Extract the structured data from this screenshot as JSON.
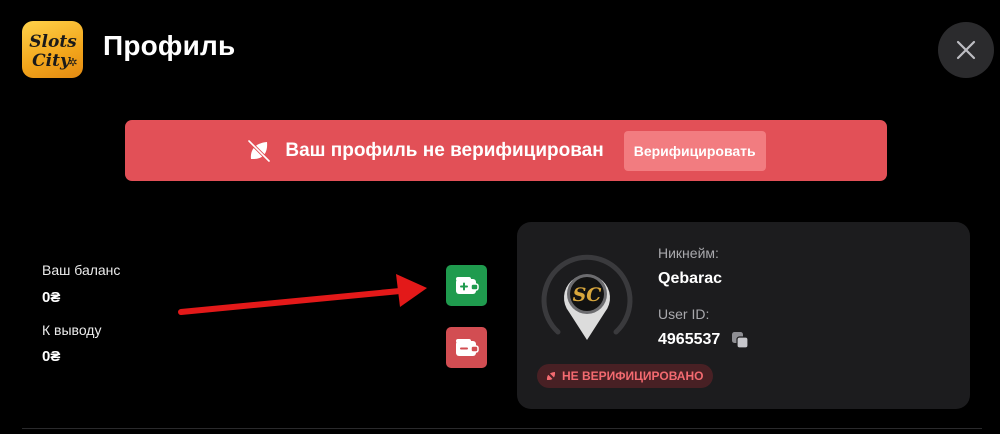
{
  "header": {
    "logo_text": "Slots City",
    "title": "Профиль",
    "close_icon": "close-icon"
  },
  "banner": {
    "icon": "unverified-leaf-icon",
    "text": "Ваш профиль не верифицирован",
    "button_label": "Верифицировать",
    "color": "#e25057"
  },
  "balance": {
    "balance_label": "Ваш баланс",
    "balance_value": "0₴",
    "withdraw_label": "К выводу",
    "withdraw_value": "0₴"
  },
  "actions": {
    "deposit_icon": "wallet-plus-icon",
    "withdraw_icon": "wallet-minus-icon",
    "deposit_color": "#1f9b4e",
    "withdraw_color": "#d24d52"
  },
  "profile": {
    "nickname_label": "Никнейм:",
    "nickname": "Qebarac",
    "userid_label": "User ID:",
    "userid": "4965537",
    "status": "НЕ ВЕРИФИЦИРОВАНО",
    "avatar_monogram": "SC"
  }
}
